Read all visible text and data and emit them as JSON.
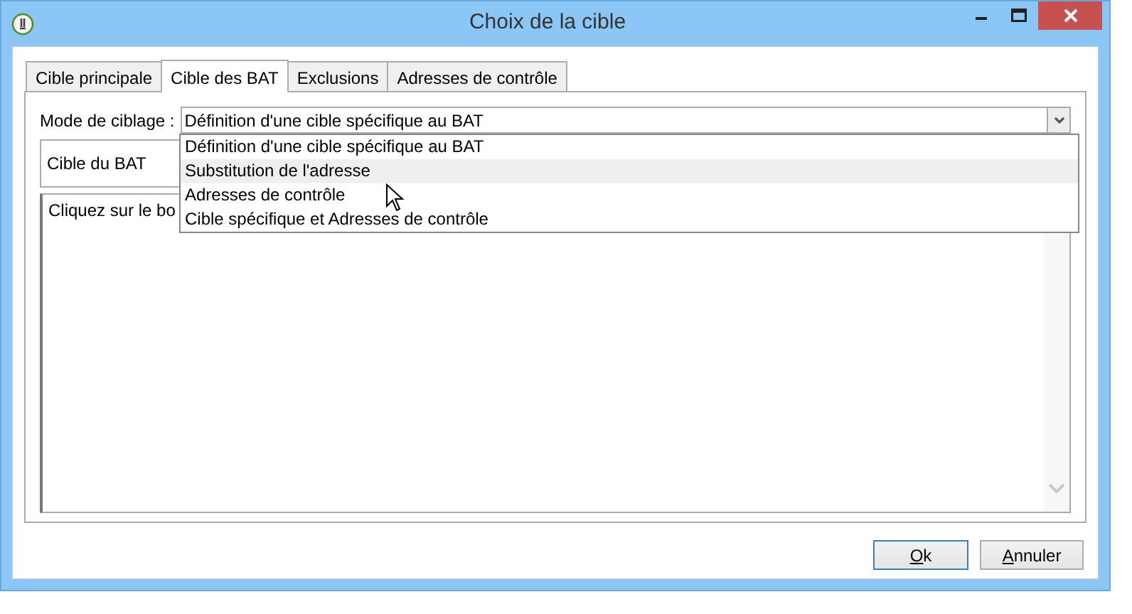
{
  "window": {
    "title": "Choix de la cible"
  },
  "tabs": [
    {
      "label": "Cible principale",
      "selected": false
    },
    {
      "label": "Cible des BAT",
      "selected": true
    },
    {
      "label": "Exclusions",
      "selected": false
    },
    {
      "label": "Adresses de contrôle",
      "selected": false
    }
  ],
  "targeting_mode": {
    "label": "Mode de ciblage :",
    "value": "Définition d'une cible spécifique au BAT",
    "options": [
      {
        "label": "Définition d'une cible spécifique au BAT",
        "highlighted": false
      },
      {
        "label": "Substitution de l'adresse",
        "highlighted": true
      },
      {
        "label": "Adresses de contrôle",
        "highlighted": false
      },
      {
        "label": "Cible spécifique et Adresses de contrôle",
        "highlighted": false
      }
    ]
  },
  "bat_target": {
    "label": "Cible du BAT"
  },
  "instructions": {
    "text": "Cliquez sur le bo"
  },
  "buttons": [
    {
      "accel": "O",
      "rest": "k",
      "default": true
    },
    {
      "accel": "A",
      "rest": "nnuler",
      "default": false
    }
  ]
}
